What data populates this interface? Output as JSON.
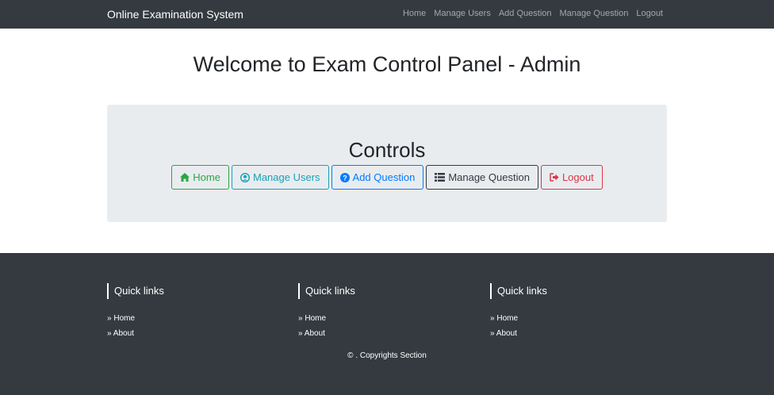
{
  "navbar": {
    "brand": "Online Examination System",
    "links": [
      "Home",
      "Manage Users",
      "Add Question",
      "Manage Question",
      "Logout"
    ]
  },
  "main": {
    "title": "Welcome to Exam Control Panel - Admin",
    "controls_title": "Controls",
    "buttons": [
      {
        "label": "Home",
        "icon": "home-icon",
        "color": "#28a745"
      },
      {
        "label": "Manage Users",
        "icon": "user-circle-icon",
        "color": "#17a2b8"
      },
      {
        "label": "Add Question",
        "icon": "question-circle-icon",
        "color": "#007bff"
      },
      {
        "label": "Manage Question",
        "icon": "list-icon",
        "color": "#343a40"
      },
      {
        "label": "Logout",
        "icon": "sign-out-icon",
        "color": "#dc3545"
      }
    ]
  },
  "footer": {
    "columns": [
      {
        "heading": "Quick links",
        "links": [
          "Home",
          "About"
        ]
      },
      {
        "heading": "Quick links",
        "links": [
          "Home",
          "About"
        ]
      },
      {
        "heading": "Quick links",
        "links": [
          "Home",
          "About"
        ]
      }
    ],
    "link_icon": "double-chevron-right-icon",
    "copyright": "© . Copyrights Section"
  },
  "colors": {
    "navbar_bg": "#343a40",
    "jumbotron_bg": "#e9ecef",
    "footer_bg": "#343a40"
  }
}
